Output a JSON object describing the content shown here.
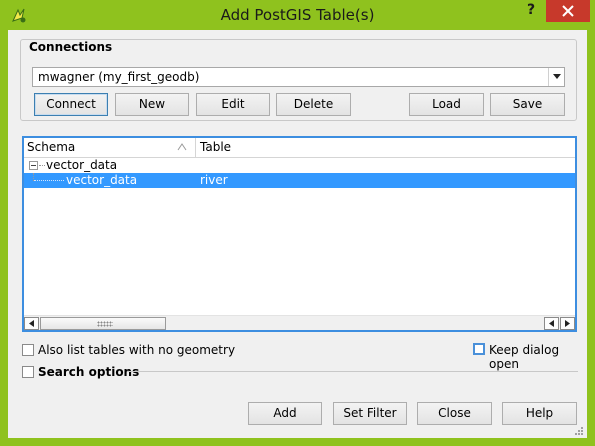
{
  "window": {
    "title": "Add PostGIS Table(s)",
    "help_glyph": "?",
    "app_icon": "qgis-icon",
    "close_icon": "close-icon"
  },
  "connections": {
    "legend": "Connections",
    "selected": "mwagner (my_first_geodb)",
    "buttons": {
      "connect": "Connect",
      "new": "New",
      "edit": "Edit",
      "delete": "Delete",
      "load": "Load",
      "save": "Save"
    }
  },
  "tree": {
    "headers": {
      "schema": "Schema",
      "table": "Table"
    },
    "rows": [
      {
        "schema": "vector_data",
        "table": "",
        "selected": false
      },
      {
        "schema": "vector_data",
        "table": "river",
        "selected": true
      }
    ]
  },
  "options": {
    "no_geometry": "Also list tables with no geometry",
    "keep_open": "Keep dialog open",
    "search_options": "Search options"
  },
  "footer": {
    "add": "Add",
    "set_filter": "Set Filter",
    "close": "Close",
    "help": "Help"
  },
  "colors": {
    "frame": "#8fc21e",
    "close_button": "#c7392b",
    "selection": "#3399ff",
    "focus_border": "#3d8ee0"
  }
}
